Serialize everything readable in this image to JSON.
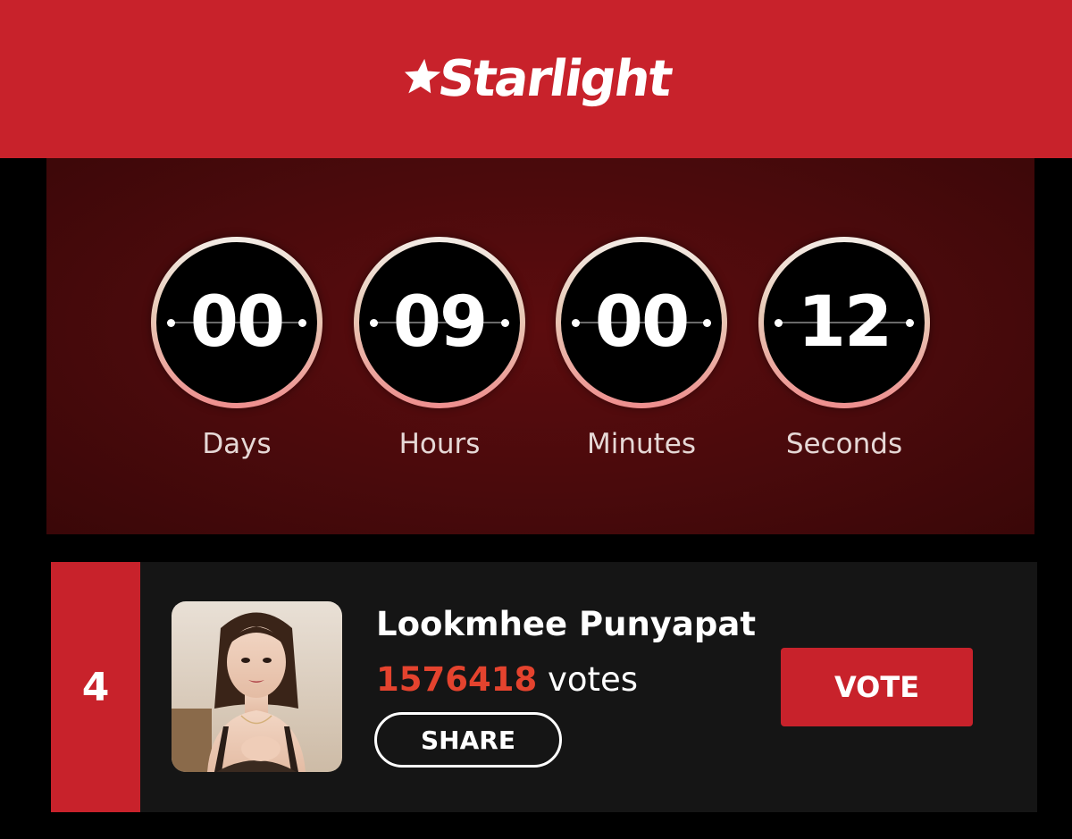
{
  "header": {
    "logo_text": "Starlight",
    "logo_icon": "star-icon"
  },
  "countdown": {
    "units": [
      {
        "value": "00",
        "label": "Days"
      },
      {
        "value": "09",
        "label": "Hours"
      },
      {
        "value": "00",
        "label": "Minutes"
      },
      {
        "value": "12",
        "label": "Seconds"
      }
    ]
  },
  "entry": {
    "rank": "4",
    "name": "Lookmhee Punyapat",
    "vote_count": "1576418",
    "votes_word": "votes",
    "share_label": "SHARE",
    "vote_label": "VOTE"
  },
  "colors": {
    "brand_red": "#c8222b",
    "vote_count": "#e4432e",
    "panel_dark_red": "#4a0a0c"
  }
}
